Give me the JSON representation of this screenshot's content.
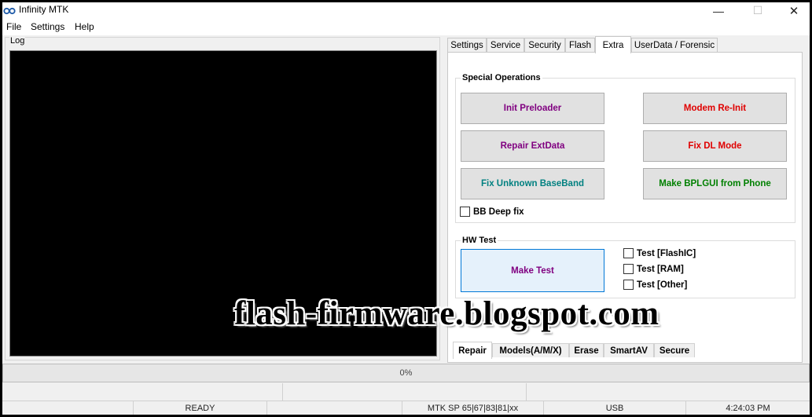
{
  "window": {
    "title": "Infinity MTK"
  },
  "menu": [
    "File",
    "Settings",
    "Help"
  ],
  "log": {
    "label": "Log"
  },
  "tabs": [
    "Settings",
    "Service",
    "Security",
    "Flash",
    "Extra",
    "UserData / Forensic"
  ],
  "active_tab": "Extra",
  "special_operations": {
    "title": "Special Operations",
    "buttons": [
      {
        "label": "Init Preloader",
        "color": "#800080"
      },
      {
        "label": "Modem Re-Init",
        "color": "#e00000"
      },
      {
        "label": "Repair ExtData",
        "color": "#800080"
      },
      {
        "label": "Fix DL Mode",
        "color": "#e00000"
      },
      {
        "label": "Fix Unknown BaseBand",
        "color": "#008080"
      },
      {
        "label": "Make BPLGUI from Phone",
        "color": "#008000"
      }
    ],
    "bb_deep_fix": "BB Deep fix"
  },
  "hw_test": {
    "title": "HW Test",
    "make_test": {
      "label": "Make Test",
      "color": "#800080"
    },
    "checks": [
      "Test [FlashIC]",
      "Test [RAM]",
      "Test [Other]"
    ]
  },
  "bottom_tabs": [
    "Repair",
    "Models(A/M/X)",
    "Erase",
    "SmartAV",
    "Secure"
  ],
  "progress": "0%",
  "status": {
    "state": "READY",
    "chip": "MTK SP 65|67|83|81|xx",
    "port": "USB",
    "time": "4:24:03 PM"
  },
  "watermark": "flash-firmware.blogspot.com"
}
